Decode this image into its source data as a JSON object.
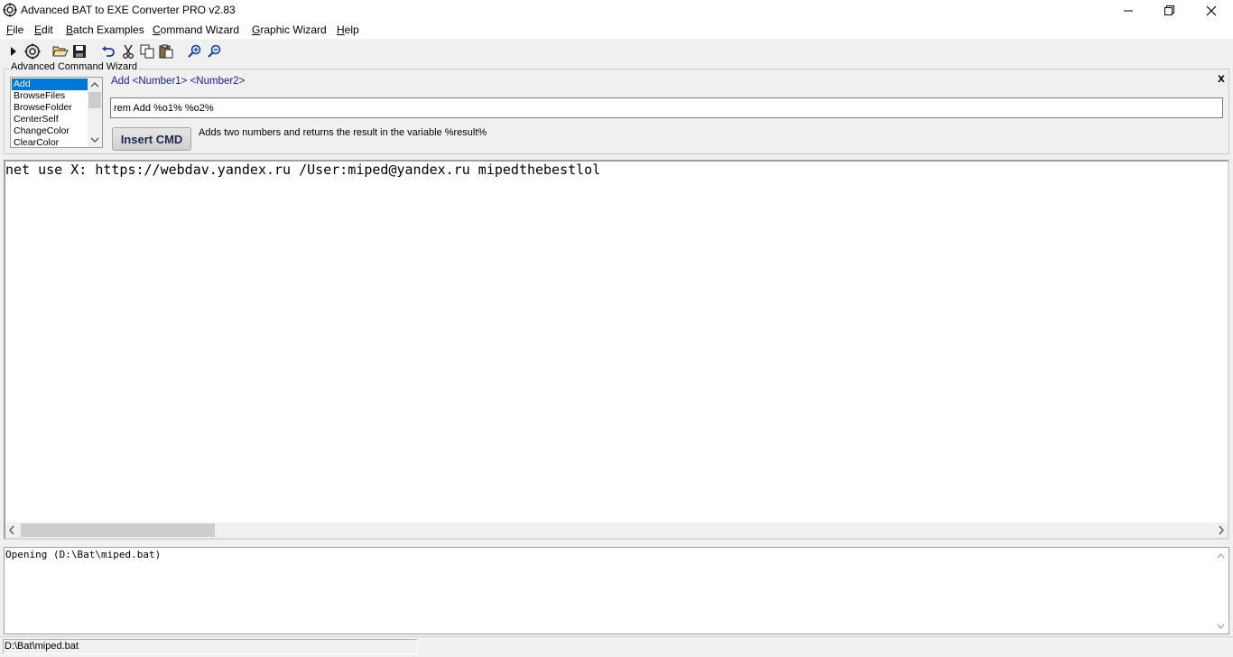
{
  "window": {
    "title": "Advanced BAT to EXE Converter PRO v2.83"
  },
  "menu": {
    "items": [
      {
        "label": "File",
        "accel": "F",
        "rest": "ile"
      },
      {
        "label": "Edit",
        "accel": "E",
        "rest": "dit"
      },
      {
        "label": "Batch Examples",
        "accel": "B",
        "rest": "atch Examples"
      },
      {
        "label": "Command Wizard",
        "accel": "C",
        "rest": "ommand Wizard"
      },
      {
        "label": "Graphic Wizard",
        "accel": "G",
        "rest": "raphic Wizard"
      },
      {
        "label": "Help",
        "accel": "H",
        "rest": "elp"
      }
    ]
  },
  "toolbar": {
    "icons": [
      "run-icon",
      "build-exe-icon",
      "open-folder-icon",
      "save-icon",
      "undo-icon",
      "cut-icon",
      "copy-icon",
      "paste-icon",
      "zoom-in-icon",
      "zoom-out-icon"
    ]
  },
  "wizard": {
    "legend": "Advanced Command Wizard",
    "commands": [
      "Add",
      "BrowseFiles",
      "BrowseFolder",
      "CenterSelf",
      "ChangeColor",
      "ClearColor"
    ],
    "selected": "Add",
    "syntax": "Add  <Number1> <Number2>",
    "rem_value": "rem Add %o1% %o2%",
    "insert_label": "Insert CMD",
    "description": "Adds two numbers and returns the result in the variable %result%",
    "close_label": "x"
  },
  "editor": {
    "text": "net use X: https://webdav.yandex.ru /User:miped@yandex.ru mipedthebestlol"
  },
  "log": {
    "text": "Opening (D:\\Bat\\miped.bat)"
  },
  "status": {
    "path": "D:\\Bat\\miped.bat"
  }
}
